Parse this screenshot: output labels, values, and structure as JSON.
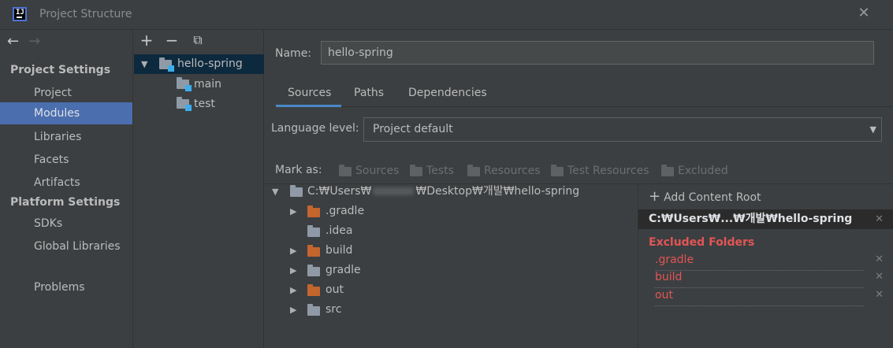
{
  "window": {
    "title": "Project Structure"
  },
  "sidebar": {
    "project_settings_heading": "Project Settings",
    "platform_settings_heading": "Platform Settings",
    "items": [
      {
        "label": "Project"
      },
      {
        "label": "Modules"
      },
      {
        "label": "Libraries"
      },
      {
        "label": "Facets"
      },
      {
        "label": "Artifacts"
      },
      {
        "label": "SDKs"
      },
      {
        "label": "Global Libraries"
      },
      {
        "label": "Problems"
      }
    ]
  },
  "module_tree": {
    "toolbar": {
      "add": "+",
      "remove": "−",
      "copy": "⧉"
    },
    "root": "hello-spring",
    "children": [
      "main",
      "test"
    ]
  },
  "module": {
    "name_label": "Name:",
    "name_value": "hello-spring",
    "tabs": [
      "Sources",
      "Paths",
      "Dependencies"
    ],
    "language_level_label": "Language level:",
    "language_level_value": "Project default",
    "mark_as_label": "Mark as:",
    "mark_as_options": [
      "Sources",
      "Tests",
      "Resources",
      "Test Resources",
      "Excluded"
    ],
    "content_root_path": "C:₩Users₩",
    "content_root_path_tail": "₩Desktop₩개발₩hello-spring",
    "folders": [
      {
        "name": ".gradle",
        "expandable": true,
        "color": "#c4652d"
      },
      {
        "name": ".idea",
        "expandable": false,
        "color": "#8f9aa6"
      },
      {
        "name": "build",
        "expandable": true,
        "color": "#c4652d"
      },
      {
        "name": "gradle",
        "expandable": true,
        "color": "#8f9aa6"
      },
      {
        "name": "out",
        "expandable": true,
        "color": "#c4652d"
      },
      {
        "name": "src",
        "expandable": true,
        "color": "#8f9aa6"
      }
    ]
  },
  "content_roots": {
    "add_label": "Add Content Root",
    "root_label": "C:₩Users₩...₩개발₩hello-spring",
    "excluded_heading": "Excluded Folders",
    "excluded": [
      ".gradle",
      "build",
      "out"
    ]
  },
  "colors": {
    "accent": "#4b6eaf",
    "excluded": "#e25555",
    "excluded_folder": "#c4652d"
  }
}
